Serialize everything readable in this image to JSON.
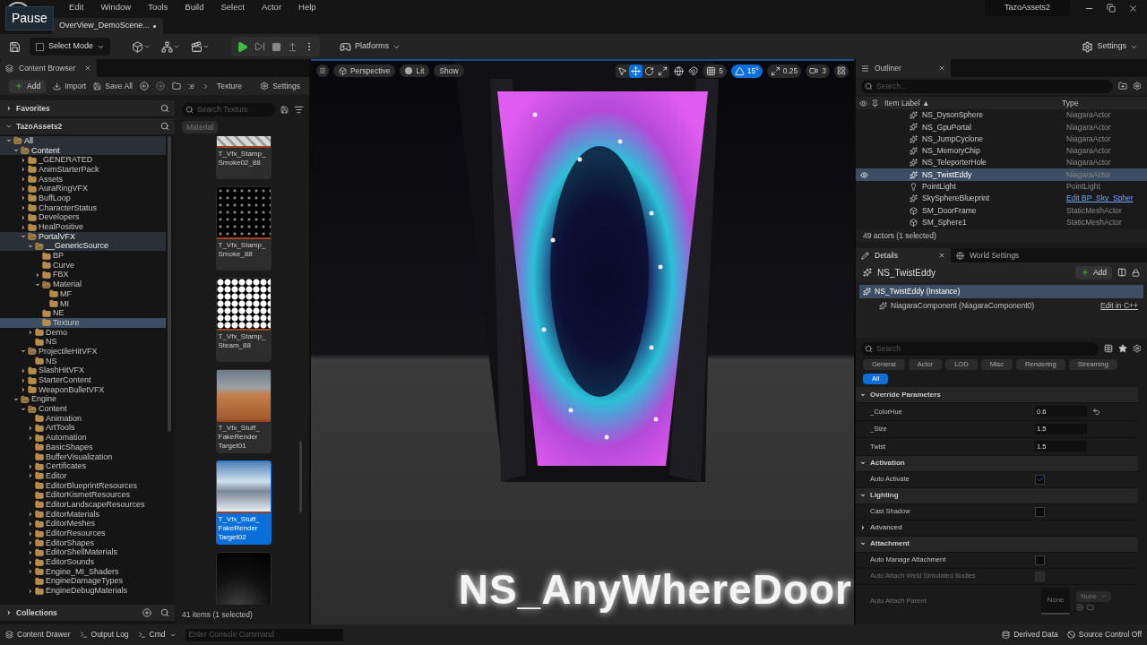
{
  "tooltip": "Pause",
  "menu": [
    "Edit",
    "Window",
    "Tools",
    "Build",
    "Select",
    "Actor",
    "Help"
  ],
  "level_tab": {
    "label": "OverView_DemoScene...",
    "modified": true
  },
  "project": "TazoAssets2",
  "toolbar": {
    "mode": "Select Mode",
    "platforms": "Platforms",
    "settings": "Settings"
  },
  "content_browser": {
    "tab": "Content Browser",
    "add": "Add",
    "import": "Import",
    "save_all": "Save All",
    "breadcrumb": [
      ":e",
      "Texture"
    ],
    "settings": "Settings",
    "favorites": "Favorites",
    "root": "TazoAssets2",
    "collections": "Collections",
    "tree": [
      {
        "label": "All",
        "expanded": true,
        "expandable": true,
        "in_path": true,
        "selected": false,
        "children": [
          {
            "label": "Content",
            "expanded": true,
            "expandable": true,
            "in_path": true,
            "selected": false,
            "children": [
              {
                "label": "_GENERATED",
                "expanded": false,
                "expandable": true,
                "in_path": false,
                "selected": false
              },
              {
                "label": "AnimStarterPack",
                "expanded": false,
                "expandable": true,
                "in_path": false,
                "selected": false
              },
              {
                "label": "Assets",
                "expanded": false,
                "expandable": true,
                "in_path": false,
                "selected": false
              },
              {
                "label": "AuraRingVFX",
                "expanded": false,
                "expandable": true,
                "in_path": false,
                "selected": false
              },
              {
                "label": "BuffLoop",
                "expanded": false,
                "expandable": true,
                "in_path": false,
                "selected": false
              },
              {
                "label": "CharacterStatus",
                "expanded": false,
                "expandable": true,
                "in_path": false,
                "selected": false
              },
              {
                "label": "Developers",
                "expanded": false,
                "expandable": true,
                "in_path": false,
                "selected": false
              },
              {
                "label": "HealPositive",
                "expanded": false,
                "expandable": true,
                "in_path": false,
                "selected": false
              },
              {
                "label": "PortalVFX",
                "expanded": true,
                "expandable": true,
                "in_path": true,
                "selected": false,
                "children": [
                  {
                    "label": "__GenericSource",
                    "expanded": true,
                    "expandable": true,
                    "in_path": true,
                    "selected": false,
                    "children": [
                      {
                        "label": "BP",
                        "expanded": false,
                        "expandable": false,
                        "in_path": false,
                        "selected": false
                      },
                      {
                        "label": "Curve",
                        "expanded": false,
                        "expandable": false,
                        "in_path": false,
                        "selected": false
                      },
                      {
                        "label": "FBX",
                        "expanded": false,
                        "expandable": true,
                        "in_path": false,
                        "selected": false
                      },
                      {
                        "label": "Material",
                        "expanded": true,
                        "expandable": true,
                        "in_path": false,
                        "selected": false,
                        "children": [
                          {
                            "label": "MF",
                            "expanded": false,
                            "expandable": false,
                            "in_path": false,
                            "selected": false
                          },
                          {
                            "label": "MI",
                            "expanded": false,
                            "expandable": false,
                            "in_path": false,
                            "selected": false
                          }
                        ]
                      },
                      {
                        "label": "NE",
                        "expanded": false,
                        "expandable": false,
                        "in_path": false,
                        "selected": false
                      },
                      {
                        "label": "Texture",
                        "expanded": false,
                        "expandable": false,
                        "in_path": false,
                        "selected": true
                      }
                    ]
                  },
                  {
                    "label": "Demo",
                    "expanded": false,
                    "expandable": true,
                    "in_path": false,
                    "selected": false
                  },
                  {
                    "label": "NS",
                    "expanded": false,
                    "expandable": false,
                    "in_path": false,
                    "selected": false
                  }
                ]
              },
              {
                "label": "ProjectileHitVFX",
                "expanded": true,
                "expandable": true,
                "in_path": false,
                "selected": false,
                "children": [
                  {
                    "label": "NS",
                    "expanded": false,
                    "expandable": false,
                    "in_path": false,
                    "selected": false
                  }
                ]
              },
              {
                "label": "SlashHitVFX",
                "expanded": false,
                "expandable": true,
                "in_path": false,
                "selected": false
              },
              {
                "label": "StarterContent",
                "expanded": false,
                "expandable": true,
                "in_path": false,
                "selected": false
              },
              {
                "label": "WeaponBulletVFX",
                "expanded": false,
                "expandable": true,
                "in_path": false,
                "selected": false
              }
            ]
          },
          {
            "label": "Engine",
            "expanded": true,
            "expandable": true,
            "in_path": false,
            "selected": false,
            "children": [
              {
                "label": "Content",
                "expanded": true,
                "expandable": true,
                "in_path": false,
                "selected": false,
                "children": [
                  {
                    "label": "Animation",
                    "expanded": false,
                    "expandable": false,
                    "in_path": false,
                    "selected": false
                  },
                  {
                    "label": "ArtTools",
                    "expanded": false,
                    "expandable": true,
                    "in_path": false,
                    "selected": false
                  },
                  {
                    "label": "Automation",
                    "expanded": false,
                    "expandable": true,
                    "in_path": false,
                    "selected": false
                  },
                  {
                    "label": "BasicShapes",
                    "expanded": false,
                    "expandable": false,
                    "in_path": false,
                    "selected": false
                  },
                  {
                    "label": "BufferVisualization",
                    "expanded": false,
                    "expandable": false,
                    "in_path": false,
                    "selected": false
                  },
                  {
                    "label": "Certificates",
                    "expanded": false,
                    "expandable": true,
                    "in_path": false,
                    "selected": false
                  },
                  {
                    "label": "Editor",
                    "expanded": false,
                    "expandable": true,
                    "in_path": false,
                    "selected": false
                  },
                  {
                    "label": "EditorBlueprintResources",
                    "expanded": false,
                    "expandable": false,
                    "in_path": false,
                    "selected": false
                  },
                  {
                    "label": "EditorKismetResources",
                    "expanded": false,
                    "expandable": false,
                    "in_path": false,
                    "selected": false
                  },
                  {
                    "label": "EditorLandscapeResources",
                    "expanded": false,
                    "expandable": false,
                    "in_path": false,
                    "selected": false
                  },
                  {
                    "label": "EditorMaterials",
                    "expanded": false,
                    "expandable": true,
                    "in_path": false,
                    "selected": false
                  },
                  {
                    "label": "EditorMeshes",
                    "expanded": false,
                    "expandable": true,
                    "in_path": false,
                    "selected": false
                  },
                  {
                    "label": "EditorResources",
                    "expanded": false,
                    "expandable": true,
                    "in_path": false,
                    "selected": false
                  },
                  {
                    "label": "EditorShapes",
                    "expanded": false,
                    "expandable": true,
                    "in_path": false,
                    "selected": false
                  },
                  {
                    "label": "EditorShellMaterials",
                    "expanded": false,
                    "expandable": true,
                    "in_path": false,
                    "selected": false
                  },
                  {
                    "label": "EditorSounds",
                    "expanded": false,
                    "expandable": true,
                    "in_path": false,
                    "selected": false
                  },
                  {
                    "label": "Engine_MI_Shaders",
                    "expanded": false,
                    "expandable": true,
                    "in_path": false,
                    "selected": false
                  },
                  {
                    "label": "EngineDamageTypes",
                    "expanded": false,
                    "expandable": false,
                    "in_path": false,
                    "selected": false
                  },
                  {
                    "label": "EngineDebugMaterials",
                    "expanded": false,
                    "expandable": true,
                    "in_path": false,
                    "selected": false
                  }
                ]
              }
            ]
          }
        ]
      }
    ],
    "search_placeholder": "Search Texture",
    "filter_chip": "Material",
    "assets": [
      {
        "lines": [
          "T_Vfx_Stamp_",
          "Smoke02_88"
        ],
        "kind": "pattern-light",
        "selected": false
      },
      {
        "lines": [
          "T_Vfx_Stamp_",
          "Smoke_88"
        ],
        "kind": "pattern-dark",
        "selected": false
      },
      {
        "lines": [
          "T_Vfx_Stamp_",
          "Steam_88"
        ],
        "kind": "pattern-white",
        "selected": false
      },
      {
        "lines": [
          "T_Vfx_Stuff_",
          "FakeRender",
          "Target01"
        ],
        "kind": "photo-desert",
        "selected": false
      },
      {
        "lines": [
          "T_Vfx_Stuff_",
          "FakeRender",
          "Target02"
        ],
        "kind": "photo-mountain",
        "selected": true
      },
      {
        "kind": "photo-smoke",
        "selected": false
      }
    ],
    "status": "41 items (1 selected)"
  },
  "viewport": {
    "view": "Perspective",
    "lighting": "Lit",
    "show": "Show",
    "tools": [
      {
        "kind": "select",
        "selected": false
      },
      {
        "kind": "translate",
        "selected": true
      },
      {
        "kind": "rotate",
        "selected": false
      },
      {
        "kind": "scale",
        "selected": false
      }
    ],
    "snaps": [
      {
        "kind": "grid",
        "value": "5",
        "on": false
      },
      {
        "kind": "angle",
        "value": "15°",
        "on": true
      },
      {
        "kind": "scale",
        "value": "0.25",
        "on": false
      }
    ],
    "camera_speed": "3",
    "scene_text": "NS_AnyWhereDoor"
  },
  "outliner": {
    "tab": "Outliner",
    "search_placeholder": "Search...",
    "columns": [
      "Item Label ▲",
      "Type"
    ],
    "rows": [
      {
        "label": "NS_DysonSphere",
        "type": "NiagaraActor",
        "kind": "niagara",
        "selected": false,
        "link": false
      },
      {
        "label": "NS_GpuPortal",
        "type": "NiagaraActor",
        "kind": "niagara",
        "selected": false,
        "link": false
      },
      {
        "label": "NS_JumpCyclone",
        "type": "NiagaraActor",
        "kind": "niagara",
        "selected": false,
        "link": false
      },
      {
        "label": "NS_MemoryChip",
        "type": "NiagaraActor",
        "kind": "niagara",
        "selected": false,
        "link": false
      },
      {
        "label": "NS_TeleporterHole",
        "type": "NiagaraActor",
        "kind": "niagara",
        "selected": false,
        "link": false
      },
      {
        "label": "NS_TwistEddy",
        "type": "NiagaraActor",
        "kind": "niagara",
        "selected": true,
        "link": false
      },
      {
        "label": "PointLight",
        "type": "PointLight",
        "kind": "light",
        "selected": false,
        "link": false
      },
      {
        "label": "SkySphereBlueprint",
        "type": "Edit BP_Sky_Spher",
        "kind": "niagara",
        "selected": false,
        "link": true
      },
      {
        "label": "SM_DoorFrame",
        "type": "StaticMeshActor",
        "kind": "mesh",
        "selected": false,
        "link": false
      },
      {
        "label": "SM_Sphere1",
        "type": "StaticMeshActor",
        "kind": "mesh",
        "selected": false,
        "link": false
      }
    ],
    "status": "49 actors (1 selected)"
  },
  "details": {
    "tabs": [
      {
        "label": "Details",
        "selected": true
      },
      {
        "label": "World Settings",
        "selected": false
      }
    ],
    "actor": "NS_TwistEddy",
    "add": "Add",
    "instance": "NS_TwistEddy (Instance)",
    "component": "NiagaraComponent (NiagaraComponent0)",
    "edit_link": "Edit in C++",
    "search_placeholder": "Search",
    "filters": [
      {
        "label": "General",
        "selected": false
      },
      {
        "label": "Actor",
        "selected": false
      },
      {
        "label": "LOD",
        "selected": false
      },
      {
        "label": "Misc",
        "selected": false
      },
      {
        "label": "Rendering",
        "selected": false
      },
      {
        "label": "Streaming",
        "selected": false
      },
      {
        "label": "All",
        "selected": true
      }
    ],
    "properties": [
      {
        "kind": "section",
        "label": "Override Parameters",
        "expanded": true
      },
      {
        "kind": "number",
        "label": "_ColorHue",
        "value": "0.6",
        "modified": true
      },
      {
        "kind": "number",
        "label": "_Size",
        "value": "1.5",
        "modified": false
      },
      {
        "kind": "number",
        "label": "Twist",
        "value": "1.5",
        "modified": false
      },
      {
        "kind": "section",
        "label": "Activation",
        "expanded": true
      },
      {
        "kind": "checkbox",
        "label": "Auto Activate",
        "checked": true,
        "disabled": false
      },
      {
        "kind": "section",
        "label": "Lighting",
        "expanded": true
      },
      {
        "kind": "checkbox",
        "label": "Cast Shadow",
        "checked": false,
        "disabled": false
      },
      {
        "kind": "advanced",
        "label": "Advanced",
        "expanded": false
      },
      {
        "kind": "section",
        "label": "Attachment",
        "expanded": true
      },
      {
        "kind": "checkbox",
        "label": "Auto Manage Attachment",
        "checked": false,
        "disabled": false
      },
      {
        "kind": "checkbox",
        "label": "Auto Attach Weld Simulated Bodies",
        "checked": false,
        "disabled": true
      },
      {
        "kind": "object",
        "label": "Auto Attach Parent",
        "thumb": "None",
        "value": "None",
        "disabled": true
      }
    ]
  },
  "bottom": {
    "content_drawer": "Content Drawer",
    "output_log": "Output Log",
    "cmd": "Cmd",
    "console_placeholder": "Enter Console Command",
    "derived_data": "Derived Data",
    "source_control": "Source Control Off"
  }
}
